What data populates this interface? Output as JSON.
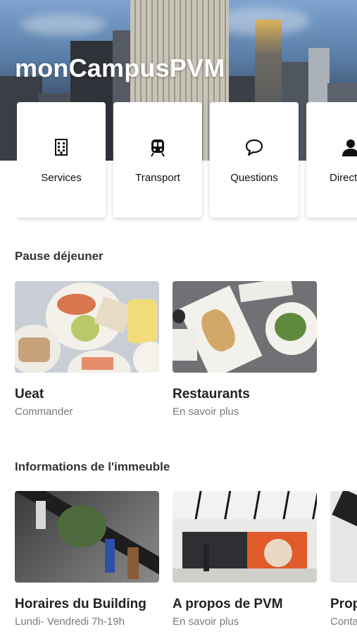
{
  "app": {
    "title": "monCampusPVM"
  },
  "quick_actions": [
    {
      "label": "Services",
      "icon": "building-icon"
    },
    {
      "label": "Transport",
      "icon": "train-icon"
    },
    {
      "label": "Questions",
      "icon": "chat-bubble-icon"
    },
    {
      "label": "Directory",
      "icon": "person-icon"
    }
  ],
  "lunch": {
    "title": "Pause déjeuner",
    "items": [
      {
        "title": "Ueat",
        "subtitle": "Commander"
      },
      {
        "title": "Restaurants",
        "subtitle": "En savoir plus"
      }
    ]
  },
  "building": {
    "title": "Informations de l'immeuble",
    "items": [
      {
        "title": "Horaires du Building",
        "subtitle": "Lundi- Vendredi 7h-19h"
      },
      {
        "title": "A propos de PVM",
        "subtitle": "En savoir plus"
      },
      {
        "title": "Propriétés",
        "subtitle": "Contact"
      }
    ]
  },
  "colors": {
    "accent": "#ffffff",
    "text": "#222222",
    "muted": "#7a7a7a"
  }
}
